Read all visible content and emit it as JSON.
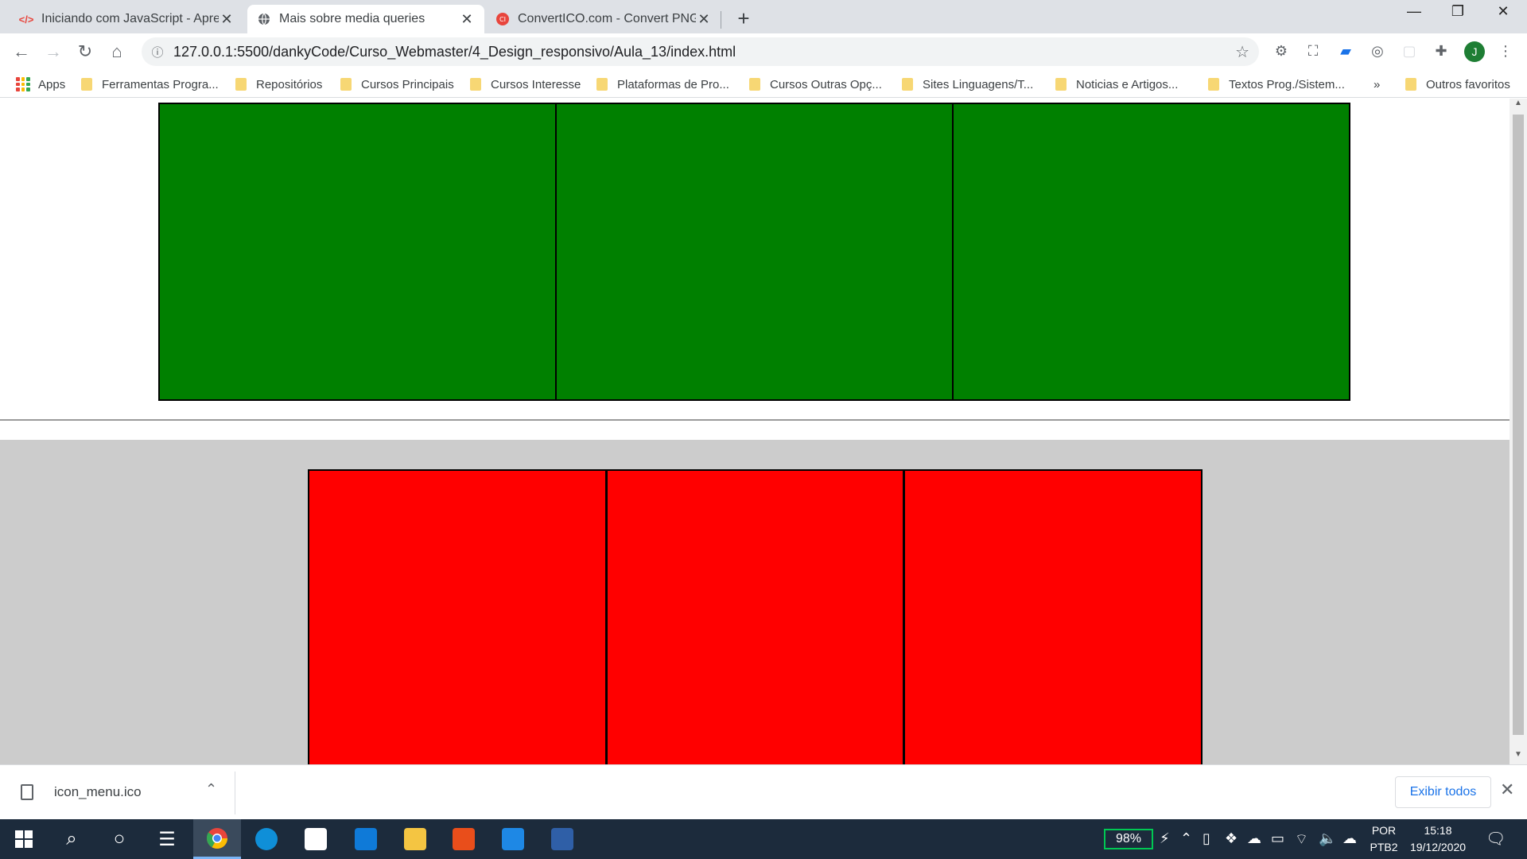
{
  "tabs": [
    {
      "title": "Iniciando com JavaScript - Apres",
      "favicon": "code-icon",
      "active": false
    },
    {
      "title": "Mais sobre media queries",
      "favicon": "globe-icon",
      "active": true
    },
    {
      "title": "ConvertICO.com - Convert PNG t",
      "favicon": "converticon-icon",
      "active": false
    }
  ],
  "omnibox": {
    "url": "127.0.0.1:5500/dankyCode/Curso_Webmaster/4_Design_responsivo/Aula_13/index.html"
  },
  "profile": {
    "initial": "J"
  },
  "bookmarks": {
    "apps_label": "Apps",
    "items": [
      "Ferramentas Progra...",
      "Repositórios",
      "Cursos Principais",
      "Cursos Interesse",
      "Plataformas de Pro...",
      "Cursos Outras Opç...",
      "Sites Linguagens/T...",
      "Noticias e Artigos...",
      "Textos Prog./Sistem..."
    ],
    "overflow": "»",
    "other": "Outros favoritos"
  },
  "page": {
    "green_color": "#008000",
    "red_color": "#ff0000",
    "section2_bg": "#cccccc"
  },
  "downloads": {
    "file": "icon_menu.ico",
    "show_all": "Exibir todos"
  },
  "taskbar": {
    "battery": "98%",
    "lang_top": "POR",
    "lang_bottom": "PTB2",
    "time": "15:18",
    "date": "19/12/2020"
  }
}
